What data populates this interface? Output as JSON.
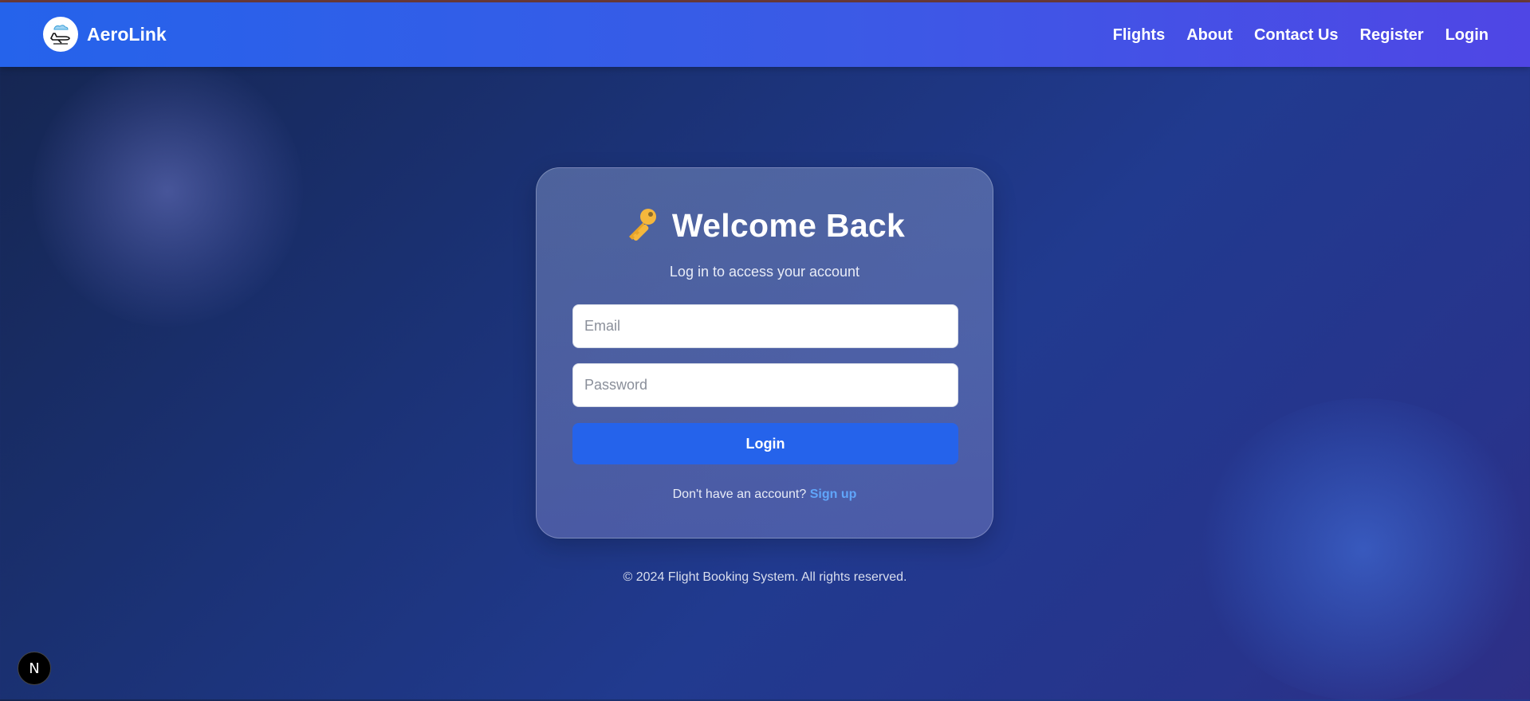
{
  "navbar": {
    "brand": "AeroLink",
    "links": [
      "Flights",
      "About",
      "Contact Us",
      "Register",
      "Login"
    ]
  },
  "login_card": {
    "icon": "key-icon",
    "title": "Welcome Back",
    "subtitle": "Log in to access your account",
    "email_placeholder": "Email",
    "password_placeholder": "Password",
    "submit_label": "Login",
    "signup_prompt": "Don't have an account?",
    "signup_link": "Sign up"
  },
  "footer": {
    "text": "© 2024 Flight Booking System. All rights reserved."
  },
  "dev_badge": {
    "letter": "N"
  },
  "colors": {
    "navbar_start": "#2563eb",
    "navbar_end": "#4f46e5",
    "button": "#2563eb",
    "link": "#60a5fa",
    "key": "#f5b73c"
  }
}
